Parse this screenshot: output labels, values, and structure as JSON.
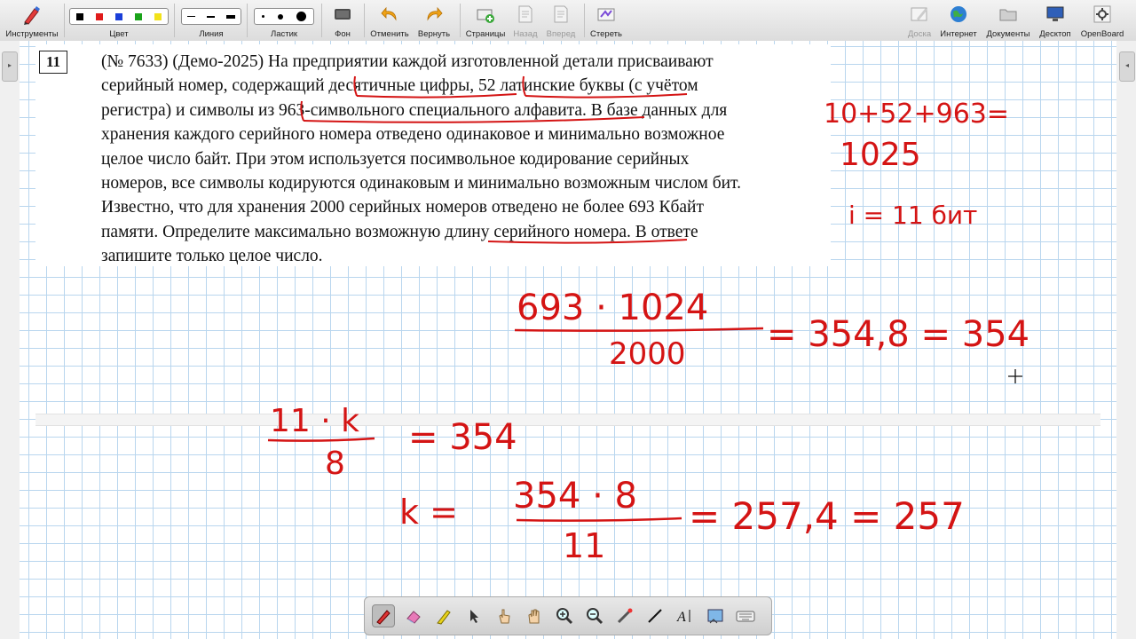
{
  "toolbar": {
    "tools_label": "Инструменты",
    "color_label": "Цвет",
    "line_label": "Линия",
    "eraser_label": "Ластик",
    "background_label": "Фон",
    "undo_label": "Отменить",
    "redo_label": "Вернуть",
    "pages_label": "Страницы",
    "back_label": "Назад",
    "forward_label": "Вперед",
    "clear_label": "Стереть",
    "board_label": "Доска",
    "internet_label": "Интернет",
    "documents_label": "Документы",
    "desktop_label": "Десктоп",
    "openboard_label": "OpenBoard",
    "colors": [
      "#000000",
      "#e01b1b",
      "#1a3fd9",
      "#1aa31a",
      "#f2e21a"
    ]
  },
  "problem": {
    "number": "11",
    "lines": [
      "(№ 7633) (Демо-2025) На предприятии каждой изготовленной детали присваивают",
      "серийный номер, содержащий десятичные цифры, 52 латинские буквы (с учётом",
      "регистра) и символы из 963-символьного специального алфавита. В базе данных для",
      "хранения каждого серийного номера отведено одинаковое и минимально возможное",
      "целое число байт. При этом используется посимвольное кодирование серийных",
      "номеров, все символы кодируются одинаковым и минимально возможным числом бит.",
      "Известно, что для хранения 2000 серийных номеров отведено не более 693 Кбайт",
      "памяти. Определите максимально возможную длину серийного номера. В ответе",
      "запишите только целое число."
    ]
  },
  "handwriting": {
    "sum": "10+52+963=",
    "sum_result": "1025",
    "bits": "i = 11 бит",
    "frac1_num": "693 · 1024",
    "frac1_den": "2000",
    "frac1_result": "= 354,8 = 354",
    "frac2_num": "11 · k",
    "frac2_den": "8",
    "frac2_result": "= 354",
    "k_label": "k =",
    "frac3_num": "354 · 8",
    "frac3_den": "11",
    "frac3_result": "= 257,4 = 257"
  },
  "accent_color": "#d41414"
}
